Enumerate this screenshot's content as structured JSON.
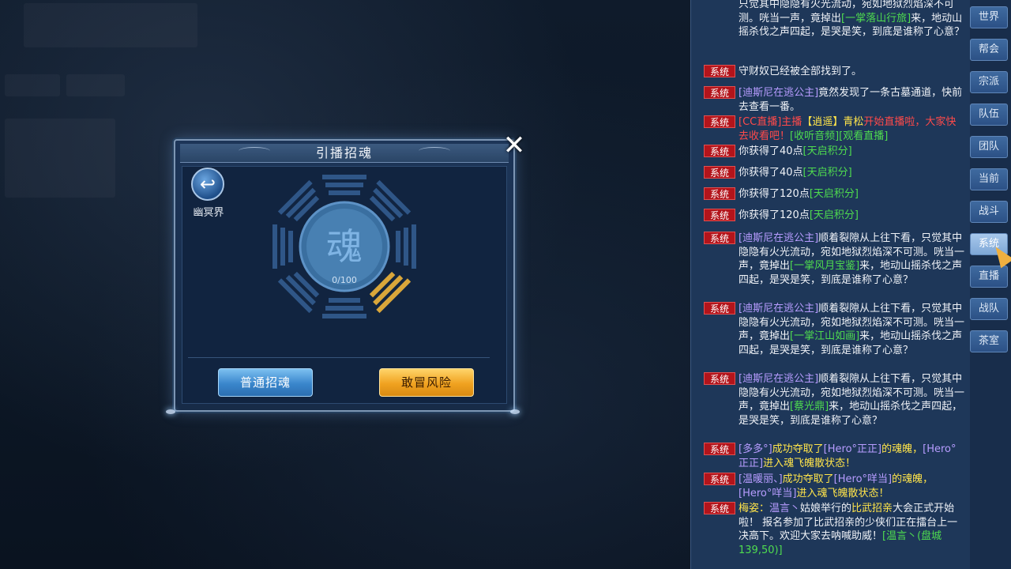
{
  "dialog": {
    "title": "引播招魂",
    "close_glyph": "✕",
    "back_label": "幽冥界",
    "soul_char": "魂",
    "soul_count": "0/100",
    "normal_button": "普通招魂",
    "risk_button": "敢冒风险"
  },
  "chat": {
    "messages": [
      {
        "tag": "",
        "parts": [
          {
            "t": "只觉其中隐隐有火光流动，宛如地狱烈焰深不可测。咣当一声，竟掉出"
          },
          {
            "t": "[一掌落山行旅]",
            "c": "c-g"
          },
          {
            "t": "来，地动山摇杀伐之声四起，是哭是笑，到底是谁称了心意？"
          }
        ]
      },
      {
        "tag": "系统",
        "parts": [
          {
            "t": "守财奴已经被全部找到了。"
          }
        ]
      },
      {
        "tag": "系统",
        "parts": [
          {
            "t": "[迪斯尼在逃公主]",
            "c": "c-p"
          },
          {
            "t": "竟然发现了一条古墓通道，快前去查看一番。"
          }
        ]
      },
      {
        "tag": "系统",
        "parts": [
          {
            "t": "[CC直播]主播",
            "c": "c-r"
          },
          {
            "t": "【逍遥】青松",
            "c": "c-y"
          },
          {
            "t": "开始直播啦，大家快去收看吧！",
            "c": "c-r"
          },
          {
            "t": "[收听音频][观看直播]",
            "c": "c-g"
          }
        ]
      },
      {
        "tag": "系统",
        "parts": [
          {
            "t": "你获得了40点"
          },
          {
            "t": "[天启积分]",
            "c": "c-g"
          }
        ]
      },
      {
        "tag": "系统",
        "parts": [
          {
            "t": "你获得了40点"
          },
          {
            "t": "[天启积分]",
            "c": "c-g"
          }
        ]
      },
      {
        "tag": "系统",
        "parts": [
          {
            "t": "你获得了120点"
          },
          {
            "t": "[天启积分]",
            "c": "c-g"
          }
        ]
      },
      {
        "tag": "系统",
        "parts": [
          {
            "t": "你获得了120点"
          },
          {
            "t": "[天启积分]",
            "c": "c-g"
          }
        ]
      },
      {
        "tag": "系统",
        "parts": [
          {
            "t": "[迪斯尼在逃公主]",
            "c": "c-p"
          },
          {
            "t": "顺着裂隙从上往下看，只觉其中隐隐有火光流动，宛如地狱烈焰深不可测。咣当一声，竟掉出"
          },
          {
            "t": "[一掌风月宝鉴]",
            "c": "c-g"
          },
          {
            "t": "来，地动山摇杀伐之声四起，是哭是笑，到底是谁称了心意？"
          }
        ]
      },
      {
        "tag": "系统",
        "parts": [
          {
            "t": "[迪斯尼在逃公主]",
            "c": "c-p"
          },
          {
            "t": "顺着裂隙从上往下看，只觉其中隐隐有火光流动，宛如地狱烈焰深不可测。咣当一声，竟掉出"
          },
          {
            "t": "[一掌江山如画]",
            "c": "c-g"
          },
          {
            "t": "来，地动山摇杀伐之声四起，是哭是笑，到底是谁称了心意？"
          }
        ]
      },
      {
        "tag": "系统",
        "parts": [
          {
            "t": "[迪斯尼在逃公主]",
            "c": "c-p"
          },
          {
            "t": "顺着裂隙从上往下看，只觉其中隐隐有火光流动，宛如地狱烈焰深不可测。咣当一声，竟掉出"
          },
          {
            "t": "[蔡光鼎]",
            "c": "c-g"
          },
          {
            "t": "来，地动山摇杀伐之声四起，是哭是笑，到底是谁称了心意？"
          }
        ]
      },
      {
        "tag": "系统",
        "parts": [
          {
            "t": "[多多°]",
            "c": "c-p"
          },
          {
            "t": "成功夺取了",
            "c": "c-y"
          },
          {
            "t": "[Hero°正正]",
            "c": "c-p"
          },
          {
            "t": "的魂魄，",
            "c": "c-y"
          },
          {
            "t": "[Hero°正正]",
            "c": "c-p"
          },
          {
            "t": "进入魂飞魄散状态！",
            "c": "c-y"
          }
        ]
      },
      {
        "tag": "系统",
        "parts": [
          {
            "t": "[温暖丽、]",
            "c": "c-p"
          },
          {
            "t": "成功夺取了",
            "c": "c-y"
          },
          {
            "t": "[Hero°咩当]",
            "c": "c-p"
          },
          {
            "t": "的魂魄，",
            "c": "c-y"
          },
          {
            "t": "[Hero°咩当]",
            "c": "c-p"
          },
          {
            "t": "进入魂飞魄散状态！",
            "c": "c-y"
          }
        ]
      },
      {
        "tag": "系统",
        "parts": [
          {
            "t": "梅姿：",
            "c": "c-y"
          },
          {
            "t": "温言丶",
            "c": "c-p"
          },
          {
            "t": "姑娘举行的"
          },
          {
            "t": "比武招亲",
            "c": "c-y"
          },
          {
            "t": "大会正式开始啦！ 报名参加了比武招亲的少侠们正在擂台上一决高下。欢迎大家去呐喊助威！"
          },
          {
            "t": "[温言丶(盘城 139,50)]",
            "c": "c-g"
          }
        ]
      }
    ]
  },
  "tabs": [
    "世界",
    "帮会",
    "宗派",
    "队伍",
    "团队",
    "当前",
    "战斗",
    "系统",
    "直播",
    "战队",
    "茶室"
  ],
  "active_tab": "系统"
}
